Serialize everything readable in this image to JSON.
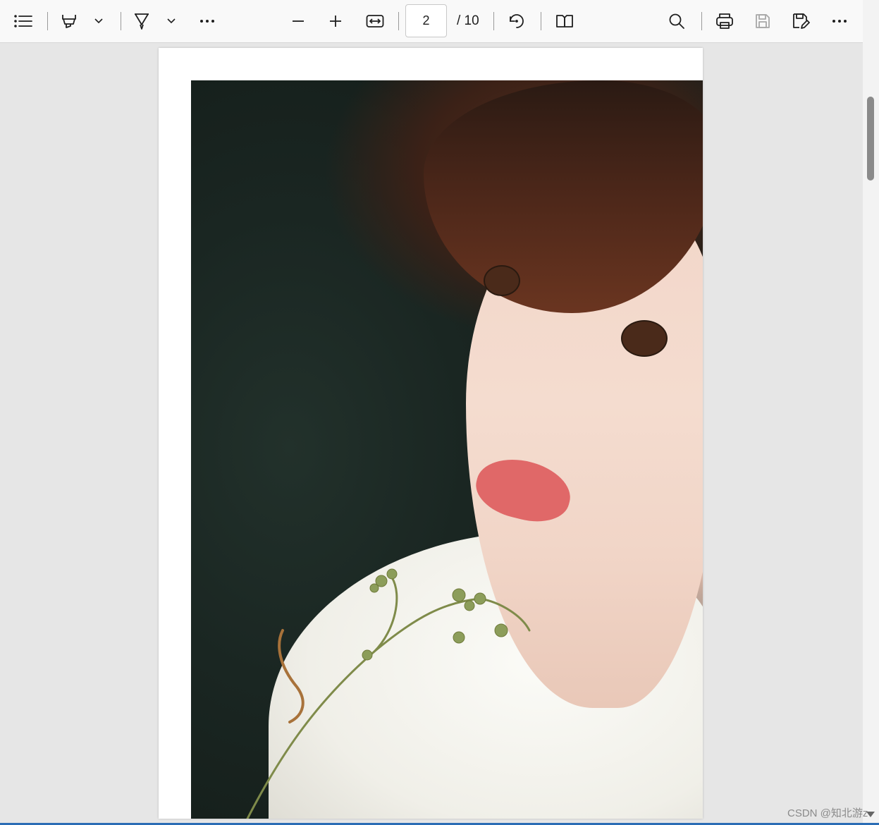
{
  "toolbar": {
    "page_current": "2",
    "page_total": "/ 10",
    "icons": {
      "contents": "table-of-contents-icon",
      "highlight": "highlighter-icon",
      "highlight_menu": "chevron-down-icon",
      "draw": "draw-icon",
      "draw_menu": "chevron-down-icon",
      "more_tools": "more-horizontal-icon",
      "zoom_out": "minus-icon",
      "zoom_in": "plus-icon",
      "fit_width": "fit-to-width-icon",
      "rotate": "rotate-icon",
      "page_view": "page-view-icon",
      "find": "search-icon",
      "print": "printer-icon",
      "save": "save-icon",
      "save_as": "save-as-icon",
      "more": "more-horizontal-icon"
    }
  },
  "document": {
    "image": "portrait-photo-woman-with-short-brown-hair-and-flowers"
  },
  "watermark": "CSDN @知北游z",
  "colors": {
    "toolbar_bg": "#f9f9f9",
    "canvas_bg": "#e6e6e6",
    "icon": "#1f1f1f",
    "disabled_icon": "#a8a8a8"
  }
}
